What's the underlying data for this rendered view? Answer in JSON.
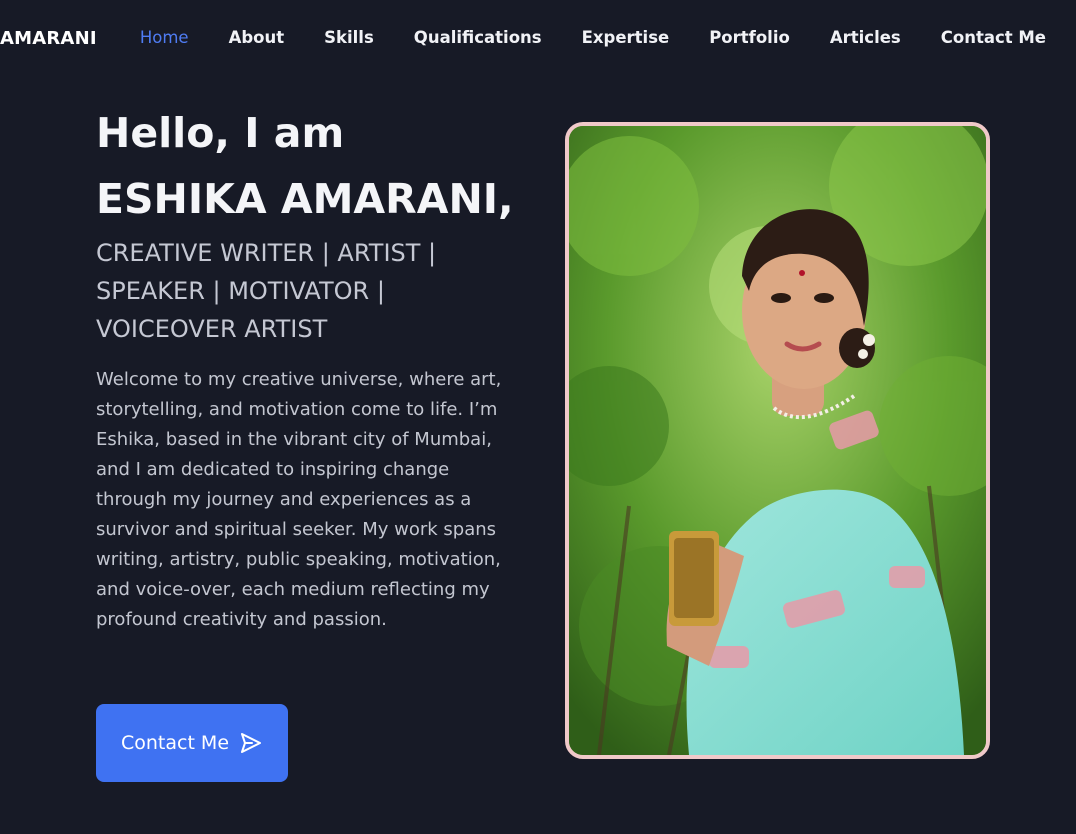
{
  "nav": {
    "brand": "AMARANI",
    "links": [
      {
        "label": "Home",
        "active": true
      },
      {
        "label": "About"
      },
      {
        "label": "Skills"
      },
      {
        "label": "Qualifications"
      },
      {
        "label": "Expertise"
      },
      {
        "label": "Portfolio"
      },
      {
        "label": "Articles"
      },
      {
        "label": "Contact Me"
      }
    ],
    "active_color": "#4f7cf3"
  },
  "hero": {
    "title": "Hello, I am ESHIKA AMARANI,",
    "roles": "CREATIVE WRITER | ARTIST | SPEAKER | MOTIVATOR | VOICEOVER ARTIST",
    "description": "Welcome to my creative universe, where art, storytelling, and motivation come to life. I’m Eshika, based in the vibrant city of Mumbai, and I am dedicated to inspiring change through my journey and experiences as a survivor and spiritual seeker. My work spans writing, artistry, public speaking, motivation, and voice-over, each medium reflecting my profound creativity and passion.",
    "cta_label": "Contact Me",
    "cta_icon": "send-icon",
    "cta_color": "#3f72f2"
  },
  "photo": {
    "frame_color": "#f0c9c9"
  },
  "colors": {
    "background": "#171a26",
    "accent": "#3f72f2"
  }
}
